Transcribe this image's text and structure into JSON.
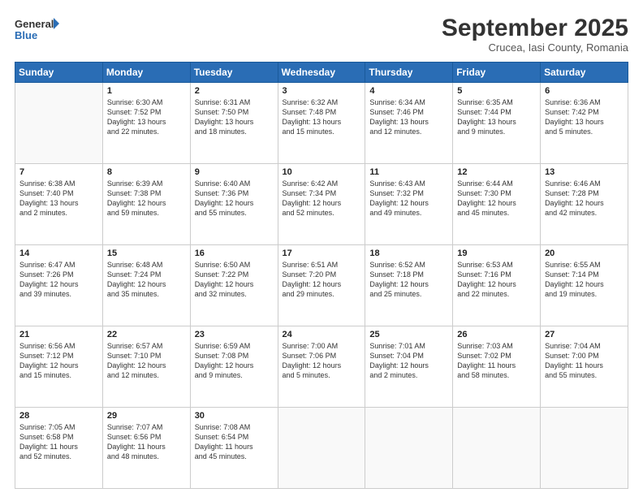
{
  "header": {
    "logo_general": "General",
    "logo_blue": "Blue",
    "month_title": "September 2025",
    "location": "Crucea, Iasi County, Romania"
  },
  "days_of_week": [
    "Sunday",
    "Monday",
    "Tuesday",
    "Wednesday",
    "Thursday",
    "Friday",
    "Saturday"
  ],
  "weeks": [
    [
      {
        "day": "",
        "info": ""
      },
      {
        "day": "1",
        "info": "Sunrise: 6:30 AM\nSunset: 7:52 PM\nDaylight: 13 hours\nand 22 minutes."
      },
      {
        "day": "2",
        "info": "Sunrise: 6:31 AM\nSunset: 7:50 PM\nDaylight: 13 hours\nand 18 minutes."
      },
      {
        "day": "3",
        "info": "Sunrise: 6:32 AM\nSunset: 7:48 PM\nDaylight: 13 hours\nand 15 minutes."
      },
      {
        "day": "4",
        "info": "Sunrise: 6:34 AM\nSunset: 7:46 PM\nDaylight: 13 hours\nand 12 minutes."
      },
      {
        "day": "5",
        "info": "Sunrise: 6:35 AM\nSunset: 7:44 PM\nDaylight: 13 hours\nand 9 minutes."
      },
      {
        "day": "6",
        "info": "Sunrise: 6:36 AM\nSunset: 7:42 PM\nDaylight: 13 hours\nand 5 minutes."
      }
    ],
    [
      {
        "day": "7",
        "info": "Sunrise: 6:38 AM\nSunset: 7:40 PM\nDaylight: 13 hours\nand 2 minutes."
      },
      {
        "day": "8",
        "info": "Sunrise: 6:39 AM\nSunset: 7:38 PM\nDaylight: 12 hours\nand 59 minutes."
      },
      {
        "day": "9",
        "info": "Sunrise: 6:40 AM\nSunset: 7:36 PM\nDaylight: 12 hours\nand 55 minutes."
      },
      {
        "day": "10",
        "info": "Sunrise: 6:42 AM\nSunset: 7:34 PM\nDaylight: 12 hours\nand 52 minutes."
      },
      {
        "day": "11",
        "info": "Sunrise: 6:43 AM\nSunset: 7:32 PM\nDaylight: 12 hours\nand 49 minutes."
      },
      {
        "day": "12",
        "info": "Sunrise: 6:44 AM\nSunset: 7:30 PM\nDaylight: 12 hours\nand 45 minutes."
      },
      {
        "day": "13",
        "info": "Sunrise: 6:46 AM\nSunset: 7:28 PM\nDaylight: 12 hours\nand 42 minutes."
      }
    ],
    [
      {
        "day": "14",
        "info": "Sunrise: 6:47 AM\nSunset: 7:26 PM\nDaylight: 12 hours\nand 39 minutes."
      },
      {
        "day": "15",
        "info": "Sunrise: 6:48 AM\nSunset: 7:24 PM\nDaylight: 12 hours\nand 35 minutes."
      },
      {
        "day": "16",
        "info": "Sunrise: 6:50 AM\nSunset: 7:22 PM\nDaylight: 12 hours\nand 32 minutes."
      },
      {
        "day": "17",
        "info": "Sunrise: 6:51 AM\nSunset: 7:20 PM\nDaylight: 12 hours\nand 29 minutes."
      },
      {
        "day": "18",
        "info": "Sunrise: 6:52 AM\nSunset: 7:18 PM\nDaylight: 12 hours\nand 25 minutes."
      },
      {
        "day": "19",
        "info": "Sunrise: 6:53 AM\nSunset: 7:16 PM\nDaylight: 12 hours\nand 22 minutes."
      },
      {
        "day": "20",
        "info": "Sunrise: 6:55 AM\nSunset: 7:14 PM\nDaylight: 12 hours\nand 19 minutes."
      }
    ],
    [
      {
        "day": "21",
        "info": "Sunrise: 6:56 AM\nSunset: 7:12 PM\nDaylight: 12 hours\nand 15 minutes."
      },
      {
        "day": "22",
        "info": "Sunrise: 6:57 AM\nSunset: 7:10 PM\nDaylight: 12 hours\nand 12 minutes."
      },
      {
        "day": "23",
        "info": "Sunrise: 6:59 AM\nSunset: 7:08 PM\nDaylight: 12 hours\nand 9 minutes."
      },
      {
        "day": "24",
        "info": "Sunrise: 7:00 AM\nSunset: 7:06 PM\nDaylight: 12 hours\nand 5 minutes."
      },
      {
        "day": "25",
        "info": "Sunrise: 7:01 AM\nSunset: 7:04 PM\nDaylight: 12 hours\nand 2 minutes."
      },
      {
        "day": "26",
        "info": "Sunrise: 7:03 AM\nSunset: 7:02 PM\nDaylight: 11 hours\nand 58 minutes."
      },
      {
        "day": "27",
        "info": "Sunrise: 7:04 AM\nSunset: 7:00 PM\nDaylight: 11 hours\nand 55 minutes."
      }
    ],
    [
      {
        "day": "28",
        "info": "Sunrise: 7:05 AM\nSunset: 6:58 PM\nDaylight: 11 hours\nand 52 minutes."
      },
      {
        "day": "29",
        "info": "Sunrise: 7:07 AM\nSunset: 6:56 PM\nDaylight: 11 hours\nand 48 minutes."
      },
      {
        "day": "30",
        "info": "Sunrise: 7:08 AM\nSunset: 6:54 PM\nDaylight: 11 hours\nand 45 minutes."
      },
      {
        "day": "",
        "info": ""
      },
      {
        "day": "",
        "info": ""
      },
      {
        "day": "",
        "info": ""
      },
      {
        "day": "",
        "info": ""
      }
    ]
  ]
}
